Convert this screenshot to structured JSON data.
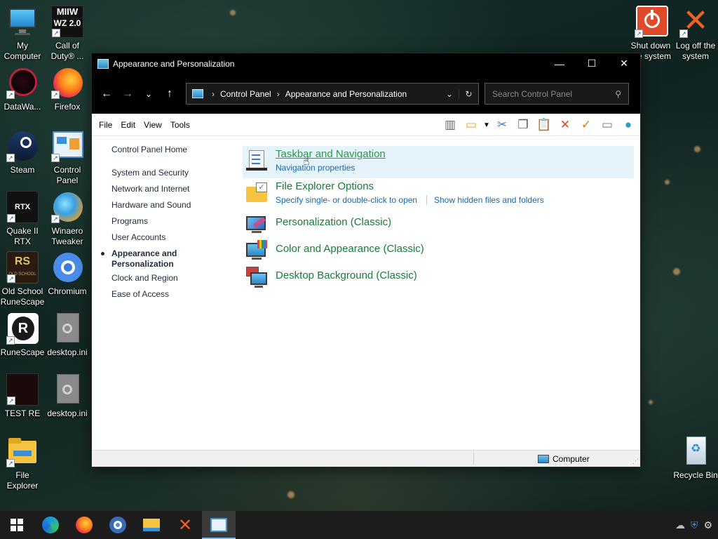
{
  "desktop": {
    "icons": [
      {
        "label": "My Computer"
      },
      {
        "label": "Call of Duty® ..."
      },
      {
        "label": "DataWa..."
      },
      {
        "label": "Firefox"
      },
      {
        "label": "Steam"
      },
      {
        "label": "Control Panel"
      },
      {
        "label": "Quake II RTX"
      },
      {
        "label": "Winaero Tweaker"
      },
      {
        "label": "Old School RuneScape"
      },
      {
        "label": "Chromium"
      },
      {
        "label": "RuneScape"
      },
      {
        "label": "desktop.ini"
      },
      {
        "label": "TEST RE"
      },
      {
        "label": "desktop.ini"
      },
      {
        "label": "File Explorer"
      },
      {
        "label": "Shut down the system"
      },
      {
        "label": "Log off the system"
      },
      {
        "label": "Recycle Bin"
      }
    ],
    "cod_logo": "MIIW",
    "cod_wz": "WZ 2.0",
    "rtx_logo": "RTX",
    "rs_logo": "RS",
    "osrs_logo": "OLD SCHOOL",
    "rs3_logo": "R"
  },
  "window": {
    "title": "Appearance and Personalization",
    "address": {
      "crumbs": [
        "Control Panel",
        "Appearance and Personalization"
      ]
    },
    "search_placeholder": "Search Control Panel",
    "menu": [
      "File",
      "Edit",
      "View",
      "Tools"
    ],
    "sidebar": {
      "home": "Control Panel Home",
      "links": [
        "System and Security",
        "Network and Internet",
        "Hardware and Sound",
        "Programs",
        "User Accounts",
        "Appearance and Personalization",
        "Clock and Region",
        "Ease of Access"
      ]
    },
    "tasks": [
      {
        "title": "Taskbar and Navigation",
        "subs": [
          "Navigation properties"
        ]
      },
      {
        "title": "File Explorer Options",
        "subs": [
          "Specify single- or double-click to open",
          "Show hidden files and folders"
        ]
      },
      {
        "title": "Personalization (Classic)",
        "subs": []
      },
      {
        "title": "Color and Appearance (Classic)",
        "subs": []
      },
      {
        "title": "Desktop Background (Classic)",
        "subs": []
      }
    ],
    "status": {
      "location": "Computer"
    }
  },
  "colors": {
    "task_title": "#1a7a3c",
    "task_link": "#1a66b0",
    "hover_bg": "#e5f3fb",
    "titlebar": "#000000"
  }
}
